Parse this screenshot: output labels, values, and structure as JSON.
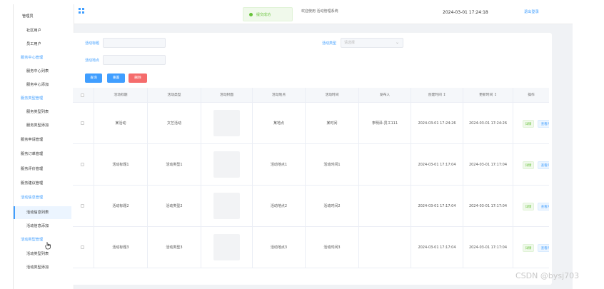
{
  "header": {
    "title_text": "欢迎使用 活动管理系统",
    "datetime": "2024-03-01 17:24:18",
    "logout": "退出登录"
  },
  "toast": {
    "message": "提交成功"
  },
  "sidebar": {
    "items": [
      {
        "label": "管理员"
      },
      {
        "label": "社区用户"
      },
      {
        "label": "员工用户"
      },
      {
        "label": "服务中心管理"
      },
      {
        "label": "服务中心列表"
      },
      {
        "label": "服务中心添加"
      },
      {
        "label": "服务类型管理"
      },
      {
        "label": "服务类型列表"
      },
      {
        "label": "服务类型添加"
      },
      {
        "label": "服务申请管理"
      },
      {
        "label": "服务订单管理"
      },
      {
        "label": "服务评价管理"
      },
      {
        "label": "服务建议管理"
      },
      {
        "label": "活动信息管理"
      },
      {
        "label": "活动信息列表"
      },
      {
        "label": "活动信息添加"
      },
      {
        "label": "活动类型管理"
      },
      {
        "label": "活动类型列表"
      },
      {
        "label": "活动类型添加"
      }
    ]
  },
  "filters": {
    "title_label": "活动标题",
    "title_value": "",
    "type_label": "活动类型",
    "type_placeholder": "请选择",
    "location_label": "活动地点",
    "location_value": "",
    "search_btn": "查询",
    "reset_btn": "重置",
    "delete_btn": "删除"
  },
  "table": {
    "columns": [
      "活动标题",
      "活动类型",
      "活动封面",
      "活动地点",
      "活动时间",
      "发布人",
      "创建时间 ↕",
      "更新时间 ↕",
      "操作"
    ],
    "rows": [
      {
        "title": "某活动",
        "type": "文艺活动",
        "location": "某地点",
        "time": "某时间",
        "publisher": "李明泽-员工111",
        "created": "2024-03-01 17:24:26",
        "updated": "2024-03-01 17:24:26"
      },
      {
        "title": "活动标题1",
        "type": "活动类型1",
        "location": "活动地点1",
        "time": "活动时间1",
        "publisher": "",
        "created": "2024-03-01 17:17:04",
        "updated": "2024-03-01 17:17:04"
      },
      {
        "title": "活动标题2",
        "type": "活动类型2",
        "location": "活动地点2",
        "time": "活动时间2",
        "publisher": "",
        "created": "2024-03-01 17:17:04",
        "updated": "2024-03-01 17:17:04"
      },
      {
        "title": "活动标题3",
        "type": "活动类型3",
        "location": "活动地点3",
        "time": "活动时间3",
        "publisher": "",
        "created": "2024-03-01 17:17:04",
        "updated": "2024-03-01 17:17:04"
      }
    ],
    "op_detail": "详情",
    "op_review": "查看评论"
  },
  "watermark": "CSDN @bysj703",
  "colors": {
    "accent": "#409eff",
    "danger": "#f56c6c",
    "success": "#67c23a"
  }
}
